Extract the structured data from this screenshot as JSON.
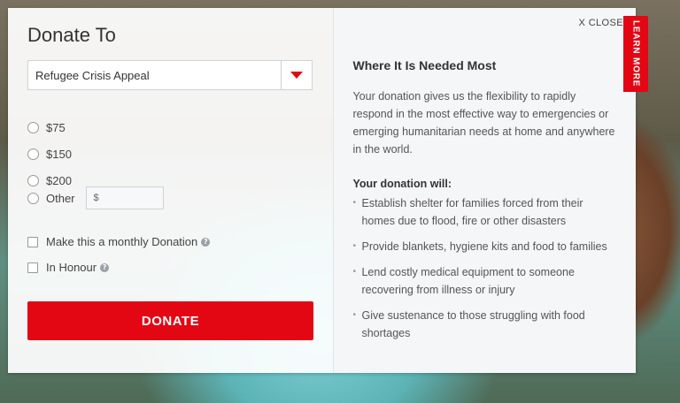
{
  "form": {
    "title": "Donate To",
    "appeal_selected": "Refugee Crisis Appeal",
    "amounts": [
      "$75",
      "$150",
      "$200"
    ],
    "other_label": "Other",
    "other_placeholder": "$",
    "monthly_label": "Make this a monthly Donation",
    "honour_label": "In Honour",
    "donate_button": "DONATE"
  },
  "info": {
    "close_label": "X CLOSE",
    "learn_more": "LEARN MORE",
    "heading": "Where It Is Needed Most",
    "description": "Your donation gives us the flexibility to rapidly respond in the most effective way to emergencies or emerging humanitarian needs at home and anywhere in the world.",
    "will_heading": "Your donation will:",
    "bullets": [
      "Establish shelter for families forced from their homes due to flood, fire or other disasters",
      "Provide blankets, hygiene kits and food to families",
      "Lend costly medical equipment to someone recovering from illness or injury",
      "Give sustenance to those struggling with food shortages"
    ]
  },
  "colors": {
    "accent": "#e30613"
  }
}
